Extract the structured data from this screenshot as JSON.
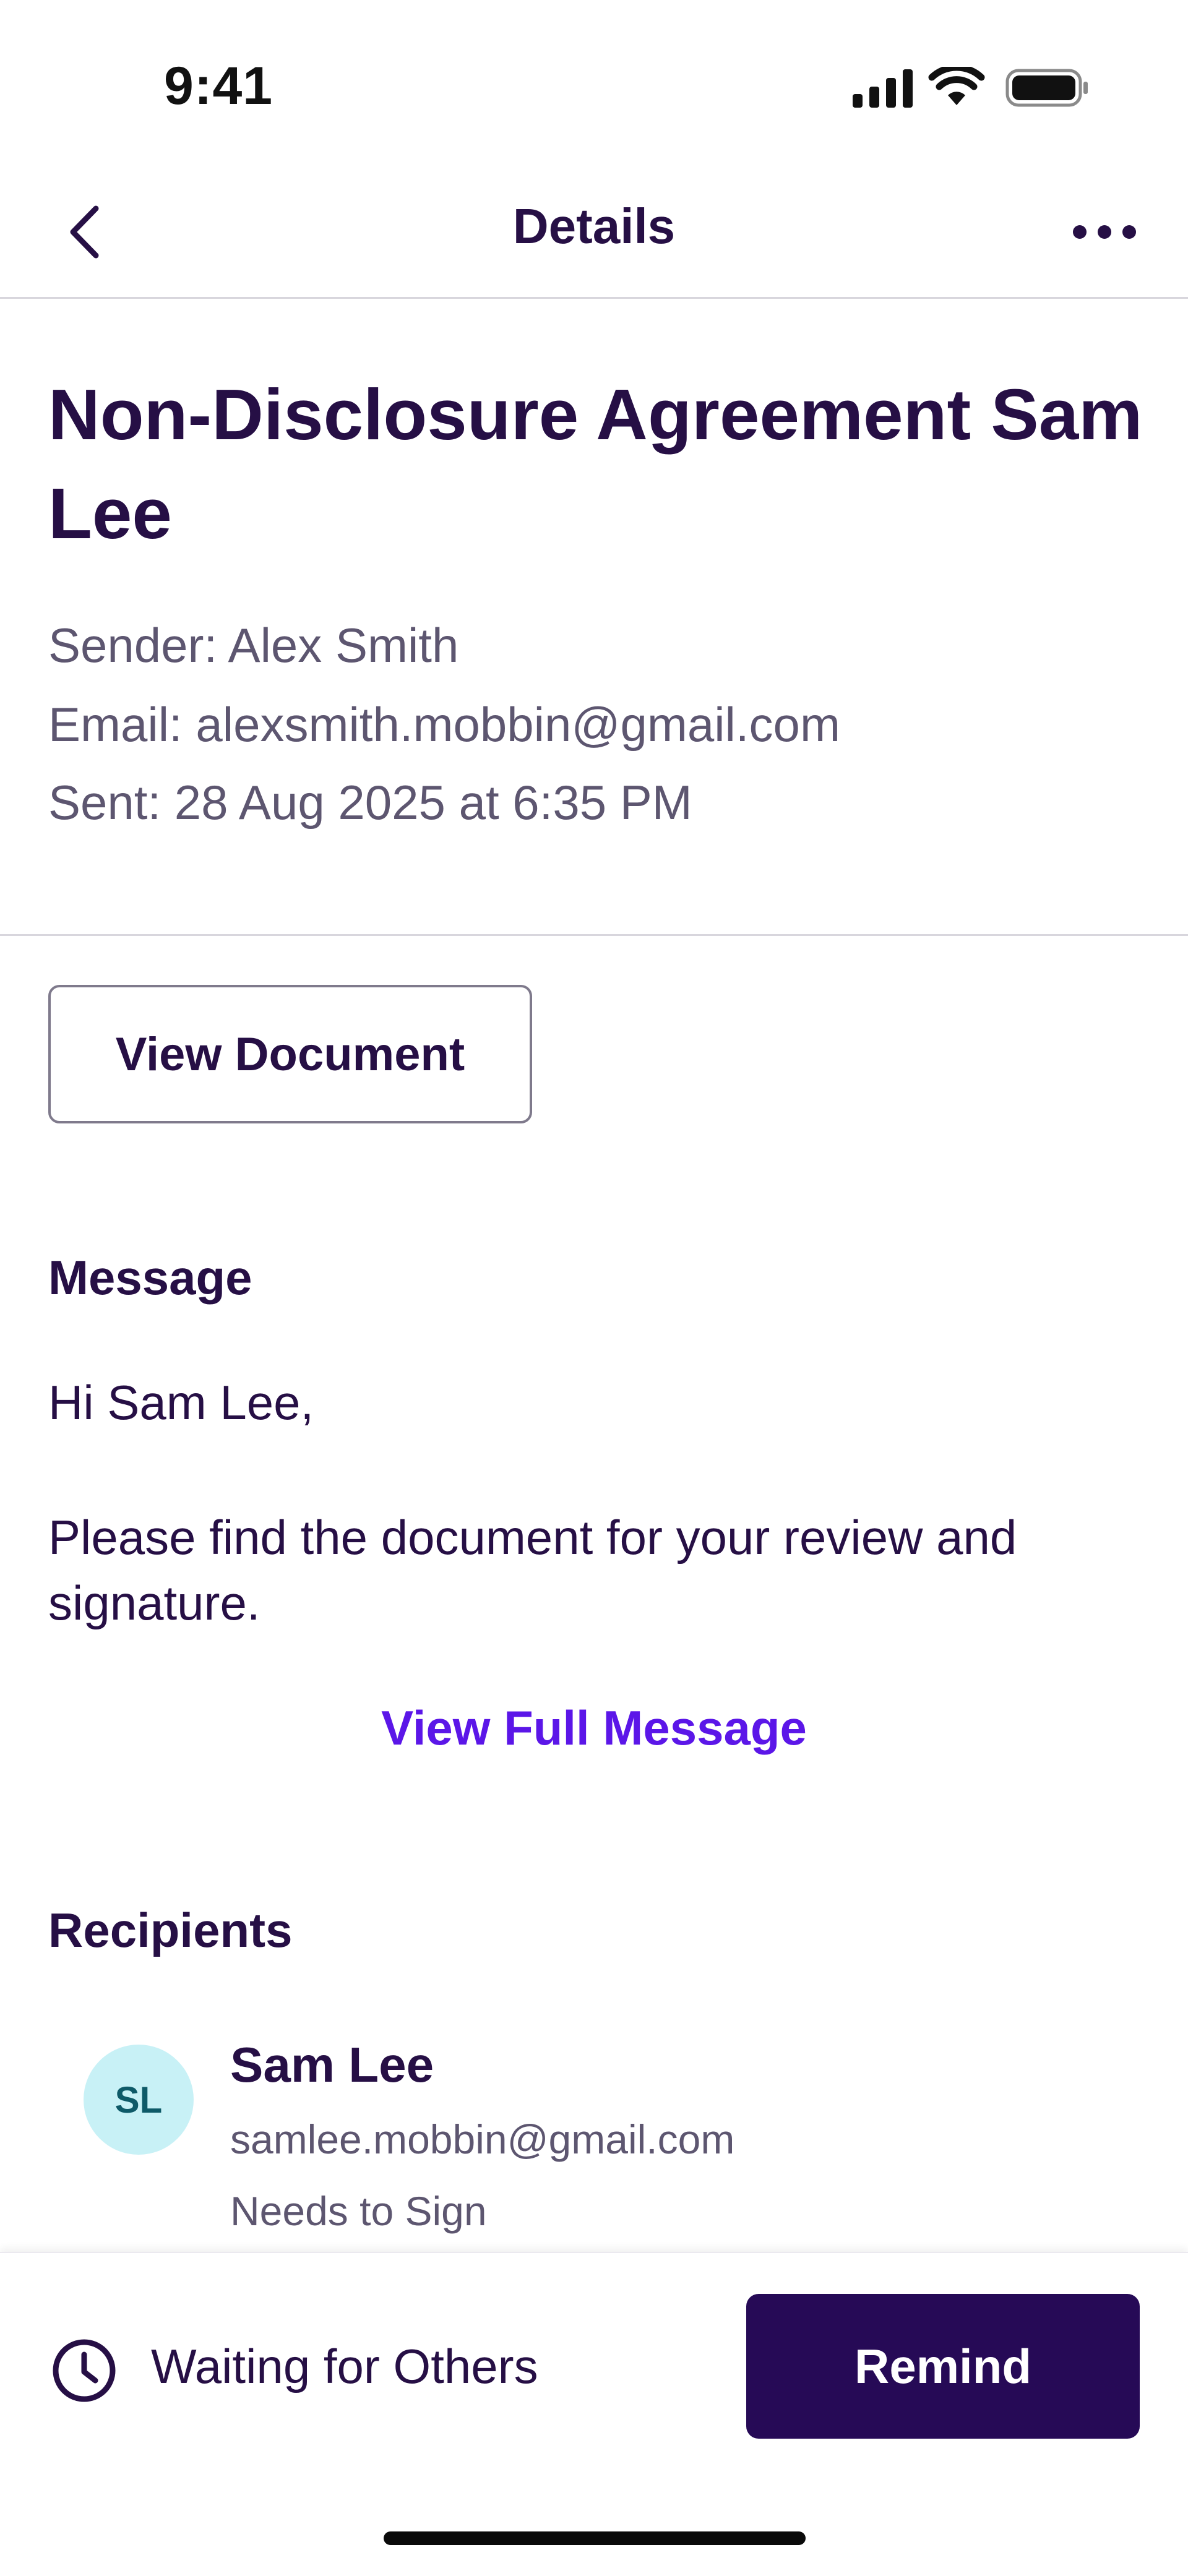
{
  "status_bar": {
    "time": "9:41"
  },
  "nav": {
    "title": "Details",
    "back_icon": "chevron-left-icon",
    "more_icon": "more-horizontal-icon"
  },
  "document": {
    "title": "Non-Disclosure Agreement Sam Lee",
    "sender": "Sender: Alex Smith",
    "email": "Email: alexsmith.mobbin@gmail.com",
    "sent": "Sent: 28 Aug 2025 at 6:35 PM",
    "view_button_label": "View Document"
  },
  "message": {
    "heading": "Message",
    "greeting": "Hi Sam Lee,",
    "body": "Please find the document for your review and signature.",
    "view_full_label": "View Full Message"
  },
  "recipients": {
    "heading": "Recipients",
    "items": [
      {
        "initials": "SL",
        "name": "Sam Lee",
        "email": "samlee.mobbin@gmail.com",
        "status": "Needs to Sign"
      }
    ]
  },
  "footer": {
    "status_icon": "clock-icon",
    "status_label": "Waiting for Others",
    "remind_label": "Remind"
  },
  "colors": {
    "primary_text": "#260f45",
    "secondary_text": "#5d5670",
    "link": "#5b16e8",
    "primary_button": "#260a56",
    "avatar_bg": "#c8f1f6"
  }
}
